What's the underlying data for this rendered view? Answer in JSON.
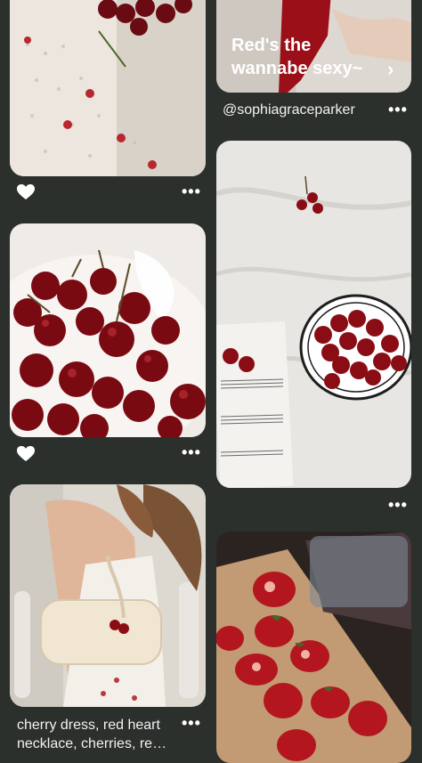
{
  "pins": [
    {
      "id": "floral-fabric",
      "alt": "floral knit fabric with cherries"
    },
    {
      "id": "red-outfit",
      "overlay_title_line1": "Red's the",
      "overlay_title_line2": "wannabe sexy~",
      "chevron": "›"
    },
    {
      "id": "cherry-bowl-closeup"
    },
    {
      "id": "cherries-sheet-music"
    },
    {
      "id": "cherry-dress-bag"
    },
    {
      "id": "strawberries-board"
    }
  ],
  "username": "@sophiagraceparker",
  "caption_cherry_dress": "cherry dress, red heart necklace, cherries, re…",
  "more_label": "•••",
  "icons": {
    "like": "heart-icon",
    "more": "more-options-icon",
    "chevron": "chevron-right-icon"
  },
  "colors": {
    "background": "#2b302d",
    "accent_red": "#8e0f17"
  }
}
